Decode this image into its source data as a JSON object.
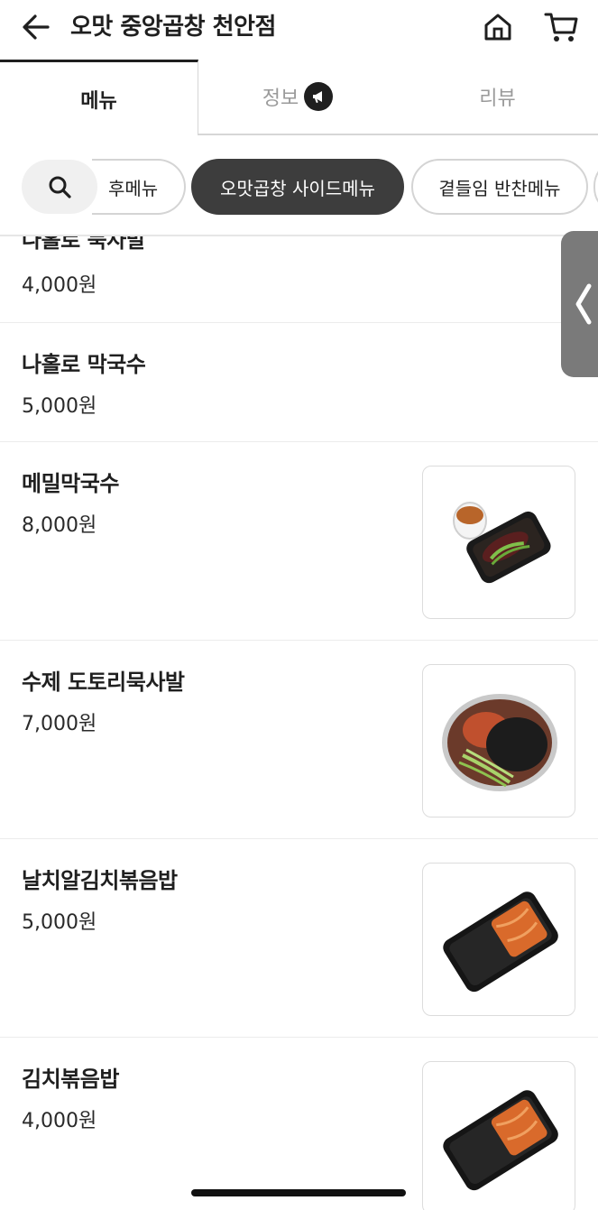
{
  "header": {
    "title": "오맛 중앙곱창 천안점",
    "back_icon": "back-arrow-icon",
    "home_icon": "home-icon",
    "cart_icon": "cart-icon"
  },
  "tabs": [
    {
      "label": "메뉴",
      "active": true
    },
    {
      "label": "정보",
      "active": false,
      "icon": "megaphone-icon"
    },
    {
      "label": "리뷰",
      "active": false
    }
  ],
  "categories": [
    {
      "label": "후메뉴",
      "selected": false
    },
    {
      "label": "오맛곱창 사이드메뉴",
      "selected": true
    },
    {
      "label": "곁들임 반찬메뉴",
      "selected": false
    },
    {
      "label": "",
      "selected": false
    }
  ],
  "menu_items": [
    {
      "name": "나홀로 묵사발",
      "price": "4,000원",
      "has_image": false
    },
    {
      "name": "나홀로 막국수",
      "price": "5,000원",
      "has_image": false
    },
    {
      "name": "메밀막국수",
      "price": "8,000원",
      "has_image": true
    },
    {
      "name": "수제 도토리묵사발",
      "price": "7,000원",
      "has_image": true
    },
    {
      "name": "날치알김치볶음밥",
      "price": "5,000원",
      "has_image": true
    },
    {
      "name": "김치볶음밥",
      "price": "4,000원",
      "has_image": true
    }
  ],
  "colors": {
    "text": "#1f1f1f",
    "inactive": "#9a9a9a",
    "selected_chip": "#3d3d3d",
    "search_chip": "#f0f0f0",
    "handle": "#7a7a7a"
  }
}
